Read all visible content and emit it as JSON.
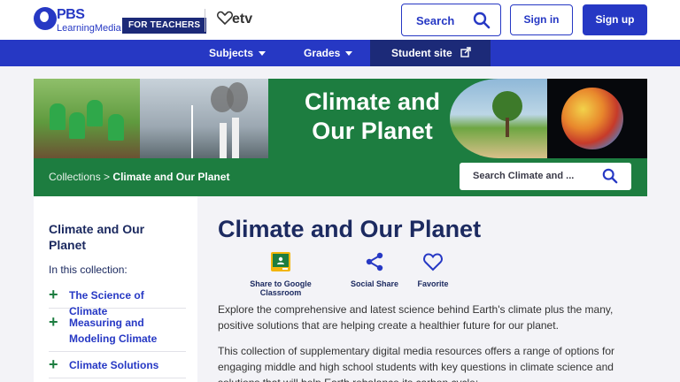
{
  "header": {
    "logo_brand": "PBS",
    "logo_sub": "LearningMedia",
    "audience_badge": "FOR TEACHERS",
    "partner_logo": "etv",
    "search_label": "Search",
    "signin_label": "Sign in",
    "signup_label": "Sign up",
    "brand_color": "#2638c4"
  },
  "nav": {
    "items": [
      {
        "label": "Subjects",
        "has_dropdown": true
      },
      {
        "label": "Grades",
        "has_dropdown": true
      },
      {
        "label": "Student site",
        "external": true
      }
    ]
  },
  "banner": {
    "title_line1": "Climate and",
    "title_line2": "Our Planet",
    "color": "#1d7d40"
  },
  "breadcrumb": {
    "root": "Collections",
    "separator": ">",
    "current": "Climate and Our Planet"
  },
  "collection_search": {
    "placeholder": "Search Climate and ..."
  },
  "sidebar": {
    "title": "Climate and Our Planet",
    "subtitle": "In this collection:",
    "items": [
      {
        "label": "The Science of Climate"
      },
      {
        "label": "Measuring and Modeling Climate"
      },
      {
        "label": "Climate Solutions"
      }
    ]
  },
  "main": {
    "title": "Climate and Our Planet",
    "actions": [
      {
        "label": "Share to Google Classroom",
        "icon": "google-classroom-icon"
      },
      {
        "label": "Social Share",
        "icon": "share-icon"
      },
      {
        "label": "Favorite",
        "icon": "heart-icon"
      }
    ],
    "paragraph1": "Explore the comprehensive and latest science behind Earth's climate plus the many, positive solutions that are helping create a healthier future for our planet.",
    "paragraph2": "This collection of supplementary digital media resources offers a range of options for engaging middle and high school students with key questions in climate science and solutions that will help Earth rebalance its carbon cycle:"
  }
}
